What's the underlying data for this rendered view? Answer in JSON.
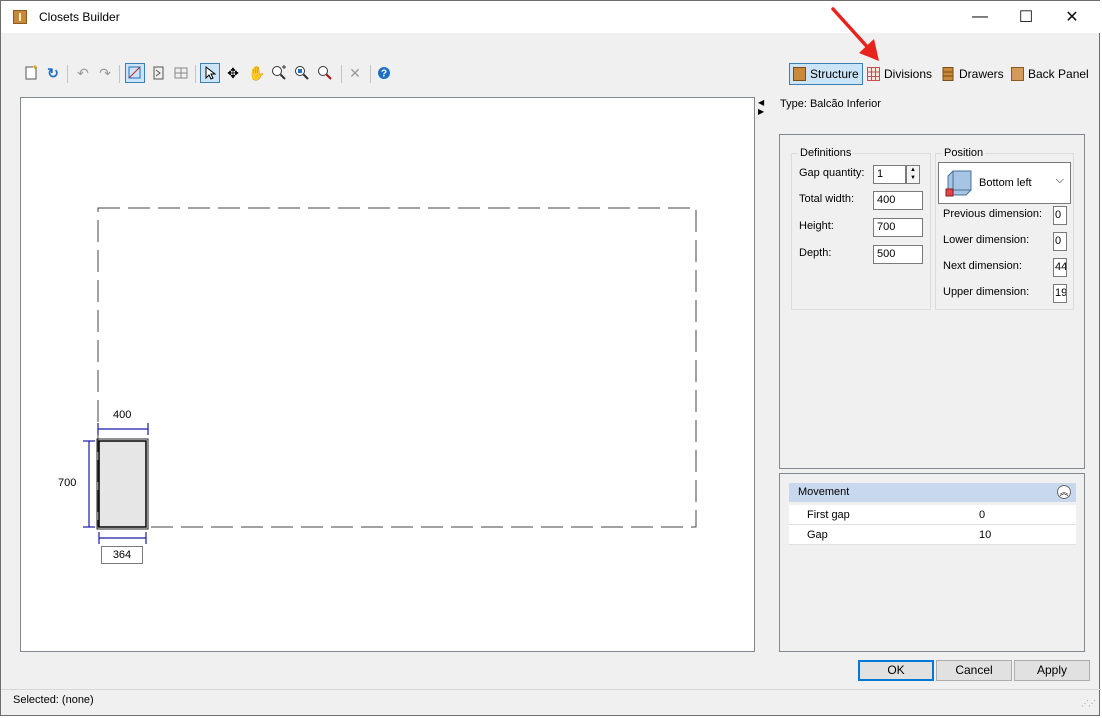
{
  "window": {
    "title": "Closets Builder",
    "controls": {
      "minimize": "—",
      "maximize": "☐",
      "close": "✕"
    }
  },
  "toolbar": {
    "icons": [
      "new-icon",
      "refresh-icon",
      "undo-icon",
      "redo-icon",
      "draw-structure-icon",
      "divider-icon",
      "grid-icon",
      "select-pointer-icon",
      "move-icon",
      "pan-hand-icon",
      "zoom-in-icon",
      "zoom-fit-icon",
      "zoom-icon",
      "delete-icon",
      "help-icon"
    ],
    "view_tabs": [
      {
        "label": "Structure",
        "icon": "structure-icon",
        "active": true
      },
      {
        "label": "Divisions",
        "icon": "divisions-icon",
        "active": false
      },
      {
        "label": "Drawers",
        "icon": "drawers-icon",
        "active": false
      },
      {
        "label": "Back Panel",
        "icon": "back-panel-icon",
        "active": false
      }
    ]
  },
  "annotation": {
    "arrow_color": "#e8231c"
  },
  "canvas": {
    "width_label": "400",
    "height_label": "700",
    "bottom_input": "364"
  },
  "properties": {
    "type_label": "Type: Balcão Inferior",
    "definitions": {
      "legend": "Definitions",
      "gap_quantity_label": "Gap quantity:",
      "gap_quantity_value": "1",
      "total_width_label": "Total width:",
      "total_width_value": "400",
      "height_label": "Height:",
      "height_value": "700",
      "depth_label": "Depth:",
      "depth_value": "500"
    },
    "position": {
      "legend": "Position",
      "selected": "Bottom left",
      "previous_label": "Previous dimension:",
      "previous_value": "0",
      "lower_label": "Lower dimension:",
      "lower_value": "0",
      "next_label": "Next dimension:",
      "next_value": "44",
      "upper_label": "Upper dimension:",
      "upper_value": "19"
    }
  },
  "movement": {
    "title": "Movement",
    "rows": [
      {
        "label": "First gap",
        "value": "0"
      },
      {
        "label": "Gap",
        "value": "10"
      }
    ]
  },
  "buttons": {
    "ok": "OK",
    "cancel": "Cancel",
    "apply": "Apply"
  },
  "status": {
    "text": "Selected: (none)"
  },
  "colors": {
    "accent": "#0078d7",
    "selection_bg": "#cce4f7",
    "dimension_line": "#1a1aa8",
    "structure_brown": "#c9883a"
  }
}
